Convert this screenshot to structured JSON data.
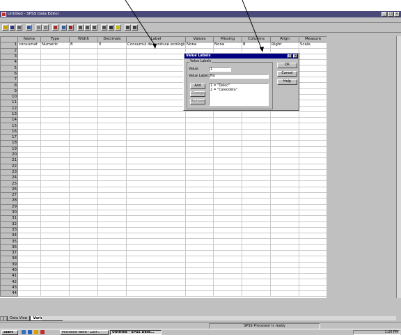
{
  "window": {
    "title": "Untitled - SPSS Data Editor"
  },
  "grid": {
    "columns": [
      "Name",
      "Type",
      "Width",
      "Decimals",
      "Label",
      "Values",
      "Missing",
      "Columns",
      "Align",
      "Measure"
    ],
    "row": [
      "consumat",
      "Numeric",
      "8",
      "0",
      "Consumul de produse ecologice",
      "None",
      "None",
      "8",
      "Right",
      "Scale"
    ],
    "row_numbers": [
      "1",
      "2",
      "3",
      "4",
      "5",
      "6",
      "7",
      "8",
      "9",
      "10",
      "11",
      "12",
      "13",
      "14",
      "15",
      "16",
      "17",
      "18",
      "19",
      "20",
      "21",
      "22",
      "23",
      "24",
      "25",
      "26",
      "27",
      "28",
      "29",
      "30",
      "31",
      "32",
      "33",
      "34",
      "35",
      "36",
      "37",
      "38",
      "39",
      "40",
      "41",
      "42",
      "43",
      "44"
    ]
  },
  "dialog": {
    "title": "Value Labels",
    "help_glyph": "?",
    "close_glyph": "×",
    "group_label": "Value Labels",
    "value_label": "Value:",
    "value": "1",
    "value_label_label": "Value Label:",
    "value_label_value": "Nu",
    "buttons": {
      "ok": "OK",
      "cancel": "Cancel",
      "help": "Help",
      "add": "Add",
      "change": "Change",
      "remove": "Remove"
    },
    "list": [
      "1 = \"Deloc\"",
      "2 = \"Caleodata\""
    ]
  },
  "tabs": [
    "Data View",
    "Variable View"
  ],
  "status": "SPSS Processor  is ready",
  "taskbar": {
    "start": "Start",
    "buttons": [
      "Microsoft Word - Lucr...",
      "Untitled - SPSS Data..."
    ],
    "clock": "1:20 PM"
  }
}
